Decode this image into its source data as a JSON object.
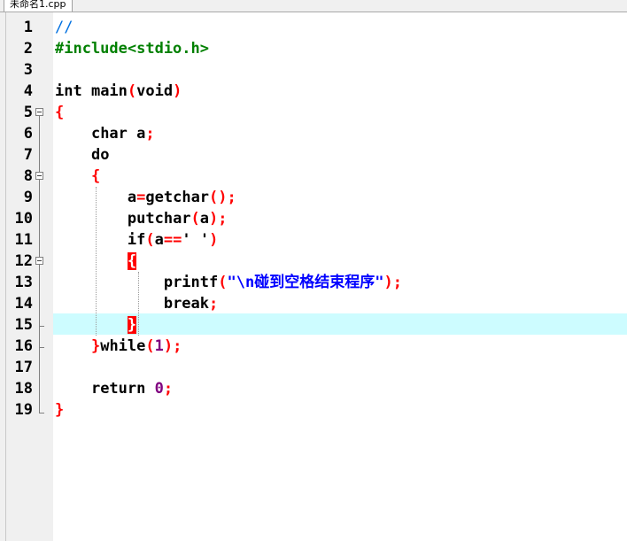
{
  "tab": {
    "title": "未命名1.cpp"
  },
  "line_numbers": [
    "1",
    "2",
    "3",
    "4",
    "5",
    "6",
    "7",
    "8",
    "9",
    "10",
    "11",
    "12",
    "13",
    "14",
    "15",
    "16",
    "17",
    "18",
    "19"
  ],
  "code": {
    "l1": {
      "comment": "//"
    },
    "l2": {
      "directive": "#include<stdio.h>"
    },
    "l4": {
      "kw_int": "int",
      "name": " main",
      "lp": "(",
      "kw_void": "void",
      "rp": ")"
    },
    "l5": {
      "brace": "{"
    },
    "l6": {
      "kw_char": "char",
      "var": " a",
      "semi": ";"
    },
    "l7": {
      "kw_do": "do"
    },
    "l8": {
      "brace": "{"
    },
    "l9": {
      "lhs": "a",
      "eq": "=",
      "fn": "getchar",
      "parens": "()",
      "semi": ";"
    },
    "l10": {
      "fn": "putchar",
      "lp": "(",
      "arg": "a",
      "rp": ")",
      "semi": ";"
    },
    "l11": {
      "kw_if": "if",
      "lp": "(",
      "arg": "a",
      "op": "==",
      "chr": "' '",
      "rp": ")"
    },
    "l12": {
      "brace": "{"
    },
    "l13": {
      "fn": "printf",
      "lp": "(",
      "str": "\"\\n碰到空格结束程序\"",
      "rp": ")",
      "semi": ";"
    },
    "l14": {
      "kw_break": "break",
      "semi": ";"
    },
    "l15": {
      "brace": "}"
    },
    "l16": {
      "brace": "}",
      "kw_while": "while",
      "lp": "(",
      "num": "1",
      "rp": ")",
      "semi": ";"
    },
    "l18": {
      "kw_return": "return",
      "num": " 0",
      "semi": ";"
    },
    "l19": {
      "brace": "}"
    }
  },
  "colors": {
    "comment": "#008000",
    "keyword": "#000000",
    "punctuation": "#ff0000",
    "number": "#800080",
    "string": "#0000ff",
    "current_line": "#cdfcff",
    "bracket_match": "#ff0000"
  }
}
